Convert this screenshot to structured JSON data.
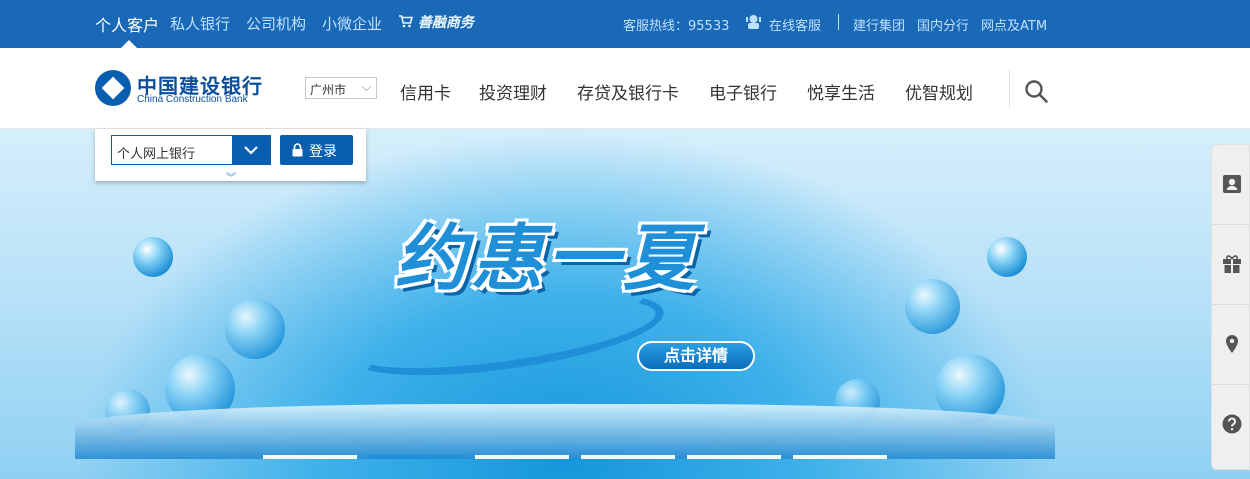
{
  "topbar": {
    "segments": [
      "个人客户",
      "私人银行",
      "公司机构",
      "小微企业"
    ],
    "shop_label": "善融商务",
    "hotline": "客服热线：95533",
    "online_service": "在线客服",
    "links": [
      "建行集团",
      "国内分行",
      "网点及ATM"
    ],
    "bg_color": "#1a69b7"
  },
  "brand": {
    "name_zh": "中国建设银行",
    "name_en": "China Construction Bank"
  },
  "city_select": {
    "value": "广州市"
  },
  "menu": [
    "信用卡",
    "投资理财",
    "存贷及银行卡",
    "电子银行",
    "悦享生活",
    "优智规划"
  ],
  "login": {
    "channel_value": "个人网上银行",
    "button_label": "登录"
  },
  "hero": {
    "title": "约惠一夏",
    "button_label": "点击详情",
    "slides_count": 6,
    "active_slide": 2
  },
  "sidebar": {
    "icons": [
      "contact-card-icon",
      "gift-icon",
      "location-pin-icon",
      "help-icon"
    ]
  }
}
